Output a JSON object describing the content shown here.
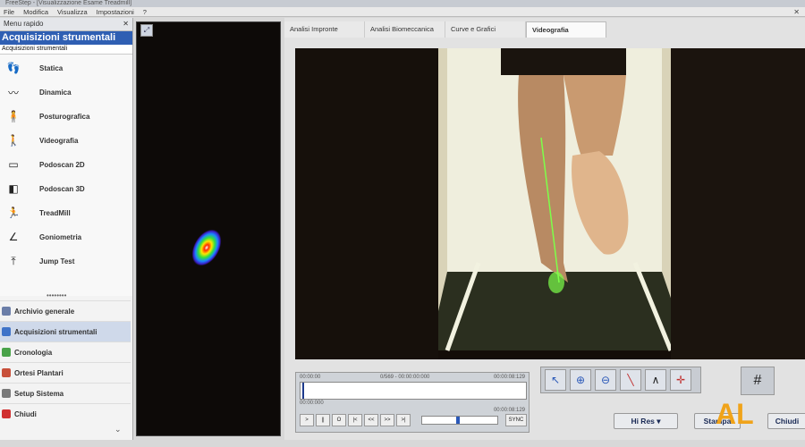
{
  "titlebar": {
    "text": "FreeStep - [Visualizzazione Esame Treadmill]"
  },
  "menu": {
    "items": [
      "File",
      "Modifica",
      "Visualizza",
      "Impostazioni",
      "?"
    ]
  },
  "sidebar": {
    "quick_menu": "Menu rapido",
    "panel_title": "Acquisizioni strumentali",
    "panel_sub": "Acquisizioni strumentali",
    "items": [
      {
        "label": "Statica",
        "icon": "feet-icon"
      },
      {
        "label": "Dinamica",
        "icon": "footprints-icon"
      },
      {
        "label": "Posturografica",
        "icon": "posture-icon"
      },
      {
        "label": "Videografia",
        "icon": "video-person-icon"
      },
      {
        "label": "Podoscan 2D",
        "icon": "scanner-icon"
      },
      {
        "label": "Podoscan 3D",
        "icon": "scanner-3d-icon"
      },
      {
        "label": "TreadMill",
        "icon": "treadmill-icon"
      },
      {
        "label": "Goniometria",
        "icon": "goniometer-icon"
      },
      {
        "label": "Jump Test",
        "icon": "jump-icon"
      }
    ],
    "nav": [
      {
        "label": "Archivio generale",
        "color": "#6b7ea8"
      },
      {
        "label": "Acquisizioni strumentali",
        "color": "#3f73c8"
      },
      {
        "label": "Cronologia",
        "color": "#4aa34a"
      },
      {
        "label": "Ortesi Plantari",
        "color": "#c8503a"
      },
      {
        "label": "Setup Sistema",
        "color": "#7a7a7a"
      },
      {
        "label": "Chiudi",
        "color": "#d03030"
      }
    ]
  },
  "tabs": [
    "Analisi Impronte",
    "Analisi Biomeccanica",
    "Curve e Grafici",
    "Videografia"
  ],
  "active_tab": "Videografia",
  "player": {
    "time_start": "00:00:00",
    "frame_info": "0/569 - 00:00:00:000",
    "time_end": "00:00:08:129",
    "time_start2": "00:00:000",
    "time_end2": "00:00:08:129",
    "controls": [
      ">",
      "||",
      "O",
      "|<",
      "<<",
      ">>",
      ">|"
    ],
    "sync_label": "SYNC"
  },
  "buttons": {
    "hires": "Hi Res",
    "print": "Stampa",
    "close": "Chiudi"
  },
  "logo_text": "AL"
}
